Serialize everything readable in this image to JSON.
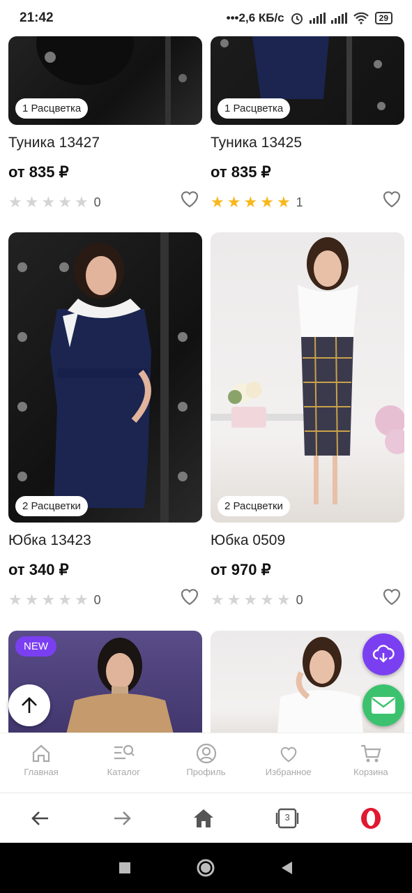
{
  "status_bar": {
    "time": "21:42",
    "network": "•••2,6 КБ/с",
    "battery": "29"
  },
  "products": [
    {
      "title": "Туника 13427",
      "price": "от 835 ₽",
      "badge": "1 Расцветка",
      "rating": 0,
      "reviews": "0"
    },
    {
      "title": "Туника 13425",
      "price": "от 835 ₽",
      "badge": "1 Расцветка",
      "rating": 5,
      "reviews": "1"
    },
    {
      "title": "Юбка 13423",
      "price": "от 340 ₽",
      "badge": "2 Расцветки",
      "rating": 0,
      "reviews": "0"
    },
    {
      "title": "Юбка 0509",
      "price": "от 970 ₽",
      "badge": "2 Расцветки",
      "rating": 0,
      "reviews": "0"
    },
    {
      "badge_new": "NEW"
    }
  ],
  "tabs": [
    {
      "label": "Главная",
      "icon": "home-icon"
    },
    {
      "label": "Каталог",
      "icon": "catalog-search-icon"
    },
    {
      "label": "Профиль",
      "icon": "profile-icon"
    },
    {
      "label": "Избранное",
      "icon": "heart-icon"
    },
    {
      "label": "Корзина",
      "icon": "cart-icon"
    }
  ],
  "browser": {
    "tab_count": "3"
  },
  "colors": {
    "accent": "#7b3ff2",
    "star": "#f8b81c",
    "mail": "#3cc26e"
  }
}
